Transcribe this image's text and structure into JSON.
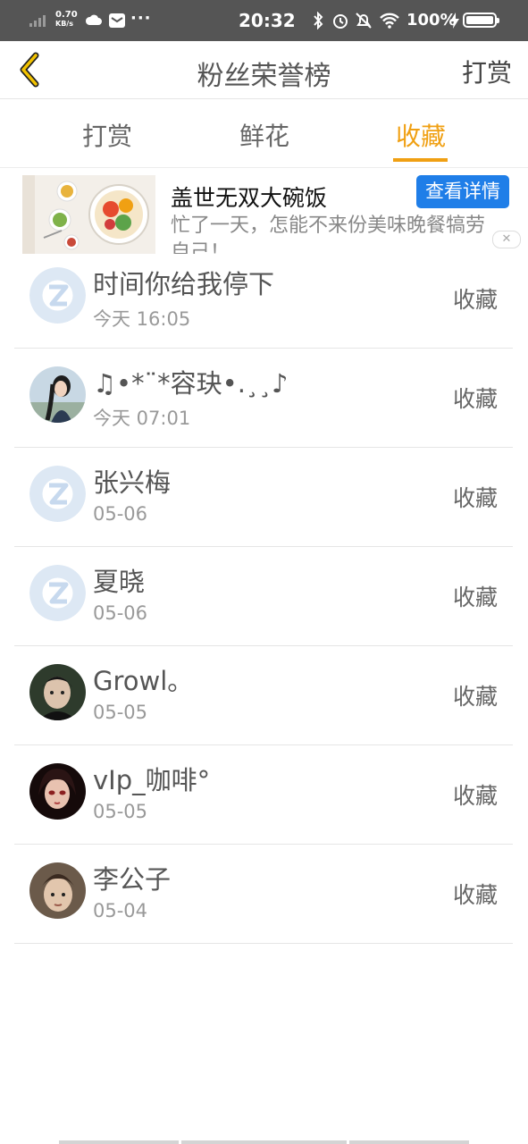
{
  "status_bar": {
    "net_speed": "0.70",
    "net_unit": "KB/s",
    "time": "20:32",
    "battery_percent": "100%",
    "icons": [
      "signal-icon",
      "cloud-icon",
      "mail-icon",
      "more-dots-icon",
      "bluetooth-icon",
      "alarm-icon",
      "mute-icon",
      "wifi-icon",
      "charging-icon",
      "battery-icon"
    ]
  },
  "header": {
    "title": "粉丝荣誉榜",
    "right_action": "打赏"
  },
  "tabs": [
    {
      "label": "打赏",
      "active": false
    },
    {
      "label": "鲜花",
      "active": false
    },
    {
      "label": "收藏",
      "active": true
    }
  ],
  "accent_color": "#f0a013",
  "ad": {
    "title": "盖世无双大碗饭",
    "description": "忙了一天，怎能不来份美味晚餐犒劳自己！",
    "button_label": "查看详情",
    "close_symbol": "✕"
  },
  "list": [
    {
      "name": "时间你给我停下",
      "date": "今天 16:05",
      "action": "收藏",
      "avatar": "default"
    },
    {
      "name": "♫•*¨*容玦•.¸¸♪",
      "date": "今天 07:01",
      "action": "收藏",
      "avatar": "photo-girl"
    },
    {
      "name": "张兴梅",
      "date": "05-06",
      "action": "收藏",
      "avatar": "default"
    },
    {
      "name": "夏晓",
      "date": "05-06",
      "action": "收藏",
      "avatar": "default"
    },
    {
      "name": "Growl。",
      "date": "05-05",
      "action": "收藏",
      "avatar": "photo-boy"
    },
    {
      "name": "vIp_咖啡°",
      "date": "05-05",
      "action": "收藏",
      "avatar": "photo-anime"
    },
    {
      "name": "李公子",
      "date": "05-04",
      "action": "收藏",
      "avatar": "photo-man"
    }
  ]
}
